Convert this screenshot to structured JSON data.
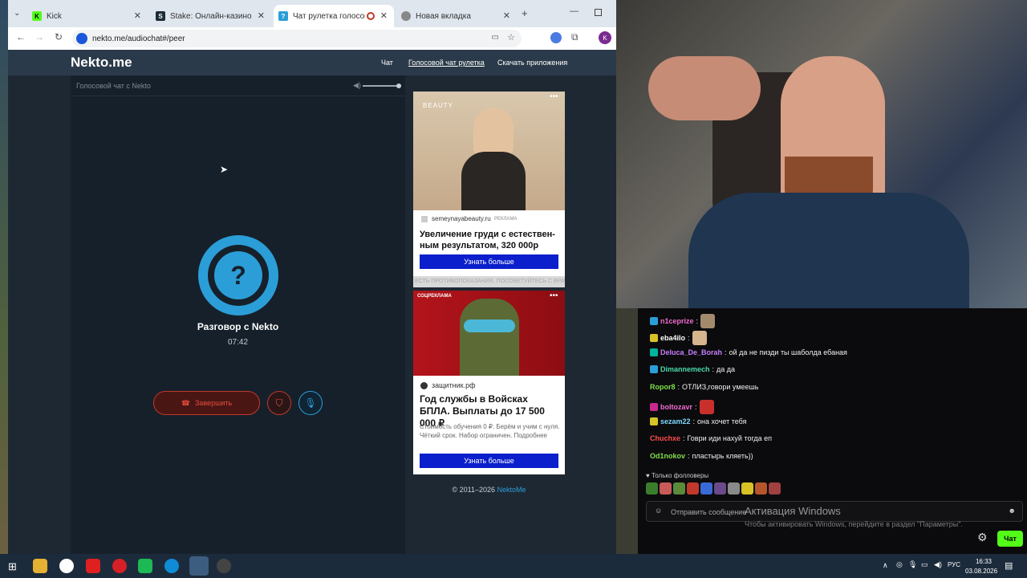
{
  "browser": {
    "tabs": [
      {
        "title": "Kick",
        "favicon": "kick-favicon"
      },
      {
        "title": "Stake: Онлайн-казино и ста",
        "favicon": "stake-favicon"
      },
      {
        "title": "Чат рулетка голосовая -",
        "favicon": "nekto-favicon"
      },
      {
        "title": "Новая вкладка",
        "favicon": "globe-favicon"
      }
    ],
    "url": "nekto.me/audiochat#/peer"
  },
  "site": {
    "logo": "Nekto.me",
    "nav": [
      "Чат",
      "Голосовой чат рулетка",
      "Скачать приложения"
    ],
    "chat_header": "Голосовой чат с Nekto",
    "volume_level": 1.0,
    "peer_title": "Разговор с Nekto",
    "timer": "07:42",
    "end_button": "Завершить",
    "copyright": "© 2011–2026",
    "copyright_link": "NektoMe"
  },
  "ads": [
    {
      "brand": "BEAUTY",
      "domain": "semeynayabeauty.ru",
      "tag": "РЕКЛАМА",
      "title": "Увеличение груди с естествен-ным результатом, 320 000р",
      "cta": "Узнать больше",
      "warning": "ЕСТЬ ПРОТИВОПОКАЗАНИЯ, ПОСОВЕТУЙТЕСЬ С ВРАЧОМ"
    },
    {
      "label": "СОЦРЕКЛАМА",
      "domain": "защитник.рф",
      "title": "Год службы в Войсках БПЛА. Выплаты до 17 500 000 ₽",
      "desc": "Стоимость обучения 0 ₽. Берём и учим с нуля. Чёткий срок. Набор ограничен. Подробнее",
      "cta": "Узнать больше"
    }
  ],
  "stream_chat": {
    "messages": [
      {
        "user": "n1ceprize",
        "color": "#f06bd0",
        "text": "",
        "badge": "#2b9ed8"
      },
      {
        "user": "eba4ilo",
        "color": "#ffffff",
        "text": "",
        "badge": "#d9c225"
      },
      {
        "user": "Deluca_De_Borah",
        "color": "#c77dff",
        "text": " ой да не пизди ты шаболда ебаная",
        "badge": "#00b39a"
      },
      {
        "user": "Dimannemech",
        "color": "#4ad9a8",
        "text": " да да",
        "badge": "#2b9ed8"
      },
      {
        "user": "Ropor8",
        "color": "#7fe04a",
        "text": " ОТЛИЗ,говори умеешь",
        "badge": ""
      },
      {
        "user": "boltozavr",
        "color": "#f06bd0",
        "text": "",
        "badge": "#c7298f"
      },
      {
        "user": "sezam22",
        "color": "#7fd9ff",
        "text": " она хочет тебя",
        "badge": "#d9c225"
      },
      {
        "user": "Chuchxe",
        "color": "#ff4d4d",
        "text": " Говри иди нахуй тогда еп",
        "badge": ""
      },
      {
        "user": "Od1nokov",
        "color": "#7fe04a",
        "text": " пластырь кляеть))",
        "badge": ""
      }
    ],
    "followers_only": "Только фолловеры",
    "input_placeholder": "Отправить сообщение",
    "send_button": "Чат",
    "watermark_title": "Активация Windows",
    "watermark_sub": "Чтобы активировать Windows, перейдите в раздел \"Параметры\"."
  },
  "taskbar": {
    "lang": "РУС",
    "time": "16:33",
    "date": "03.08.2026"
  }
}
